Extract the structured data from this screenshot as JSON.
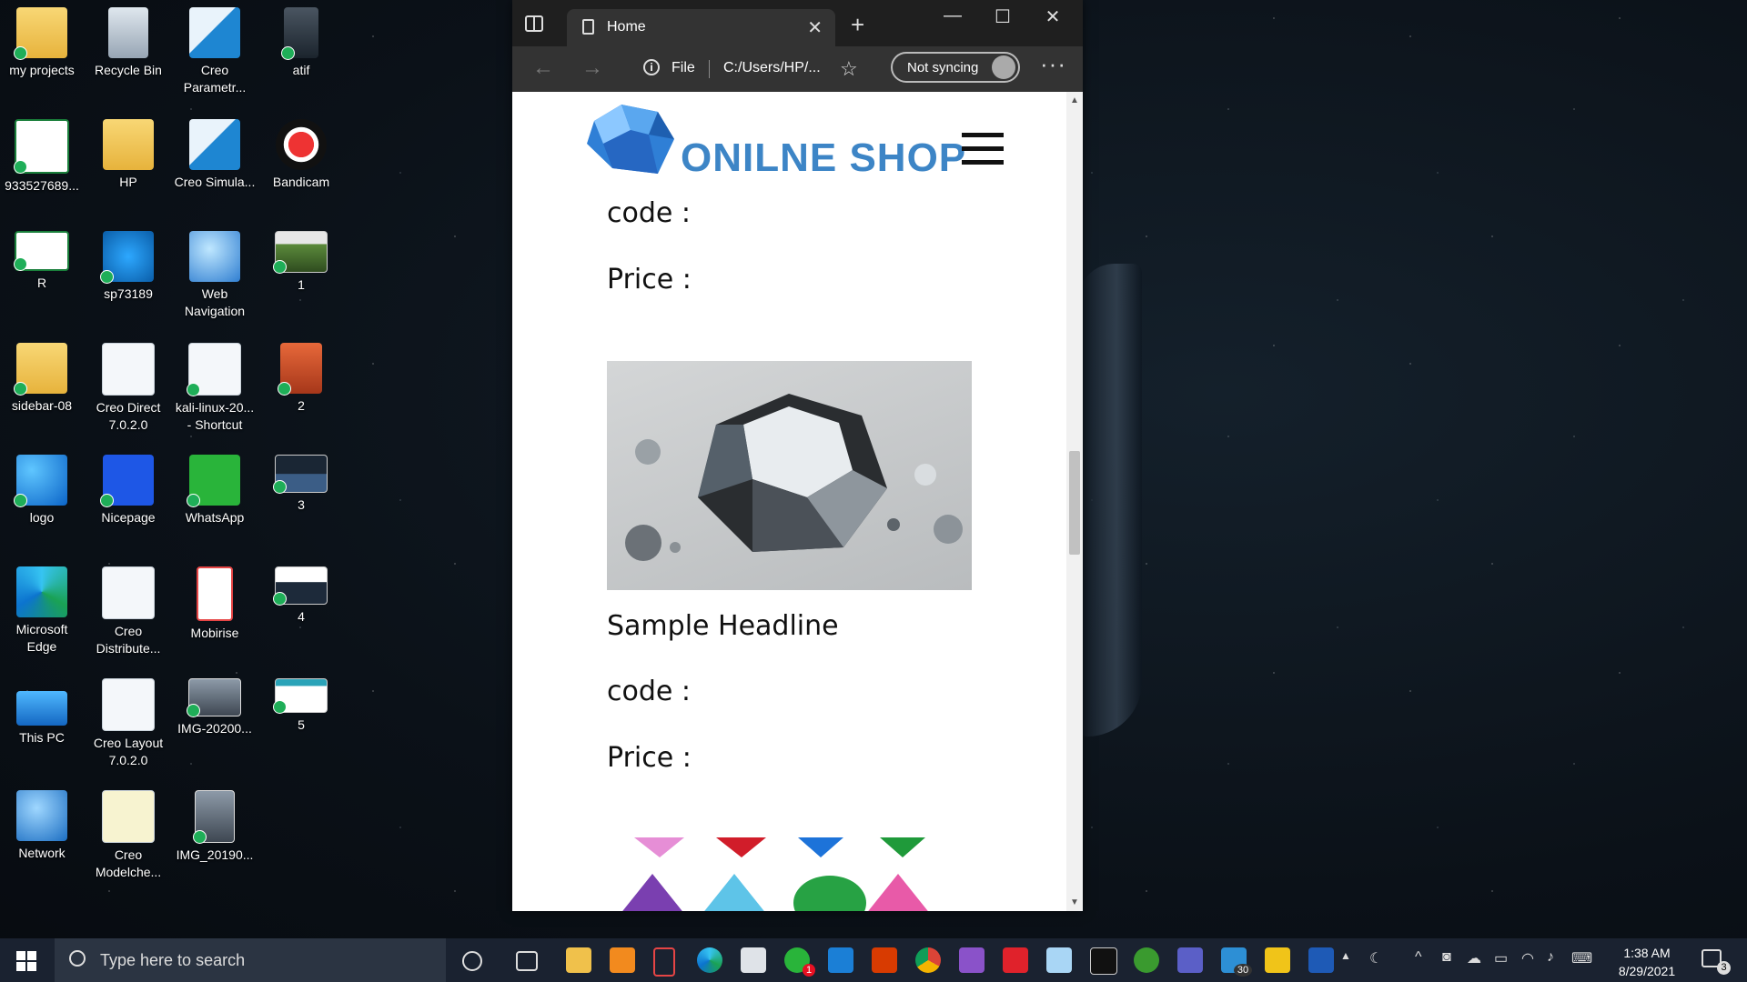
{
  "desktop": {
    "icons": [
      {
        "label": "my projects",
        "icon": "folder-icon"
      },
      {
        "label": "Recycle Bin",
        "icon": "recycle-bin-icon"
      },
      {
        "label": "Creo Parametr...",
        "icon": "creo-parametric-icon"
      },
      {
        "label": "atif",
        "icon": "person-photo-icon"
      },
      {
        "label": "933527689...",
        "icon": "flag-icon"
      },
      {
        "label": "HP",
        "icon": "user-folder-icon"
      },
      {
        "label": "Creo Simula...",
        "icon": "creo-simulate-icon"
      },
      {
        "label": "Bandicam",
        "icon": "bandicam-icon"
      },
      {
        "label": "R",
        "icon": "flag-icon"
      },
      {
        "label": "sp73189",
        "icon": "hp-icon"
      },
      {
        "label": "Web Navigation",
        "icon": "globe-icon"
      },
      {
        "label": "1",
        "icon": "thumbnail-icon"
      },
      {
        "label": "sidebar-08",
        "icon": "zip-folder-icon"
      },
      {
        "label": "Creo Direct 7.0.2.0",
        "icon": "creo-direct-icon"
      },
      {
        "label": "kali-linux-20... - Shortcut",
        "icon": "shortcut-icon"
      },
      {
        "label": "2",
        "icon": "book-icon"
      },
      {
        "label": "logo",
        "icon": "logo-icon"
      },
      {
        "label": "Nicepage",
        "icon": "nicepage-icon"
      },
      {
        "label": "WhatsApp",
        "icon": "whatsapp-icon"
      },
      {
        "label": "3",
        "icon": "thumbnail-icon"
      },
      {
        "label": "Microsoft Edge",
        "icon": "edge-icon"
      },
      {
        "label": "Creo Distribute...",
        "icon": "creo-distribute-icon"
      },
      {
        "label": "Mobirise",
        "icon": "mobirise-icon"
      },
      {
        "label": "4",
        "icon": "thumbnail-icon"
      },
      {
        "label": "This PC",
        "icon": "computer-icon"
      },
      {
        "label": "Creo Layout 7.0.2.0",
        "icon": "creo-layout-icon"
      },
      {
        "label": "IMG-20200...",
        "icon": "photo-icon"
      },
      {
        "label": "5",
        "icon": "thumbnail-icon"
      },
      {
        "label": "Network",
        "icon": "network-icon"
      },
      {
        "label": "Creo Modelche...",
        "icon": "creo-modelcheck-icon"
      },
      {
        "label": "IMG_20190...",
        "icon": "photo-icon"
      }
    ]
  },
  "browser": {
    "tab_title": "Home",
    "address_scheme": "File",
    "address_url": "C:/Users/HP/...",
    "sync_label": "Not syncing",
    "more_label": "···"
  },
  "site": {
    "title": "ONILNE SHOP",
    "products": [
      {
        "code_label": "code :",
        "price_label": "Price :"
      },
      {
        "headline": "Sample Headline",
        "code_label": "code :",
        "price_label": "Price :"
      }
    ]
  },
  "taskbar": {
    "search_placeholder": "Type here to search",
    "whatsapp_badge": "1",
    "calendar_badge": "30",
    "time": "1:38 AM",
    "date": "8/29/2021",
    "notification_count": "3"
  },
  "colors": {
    "site_title": "#3d85c6",
    "browser_chrome": "#333333",
    "taskbar": "#1a2230"
  }
}
